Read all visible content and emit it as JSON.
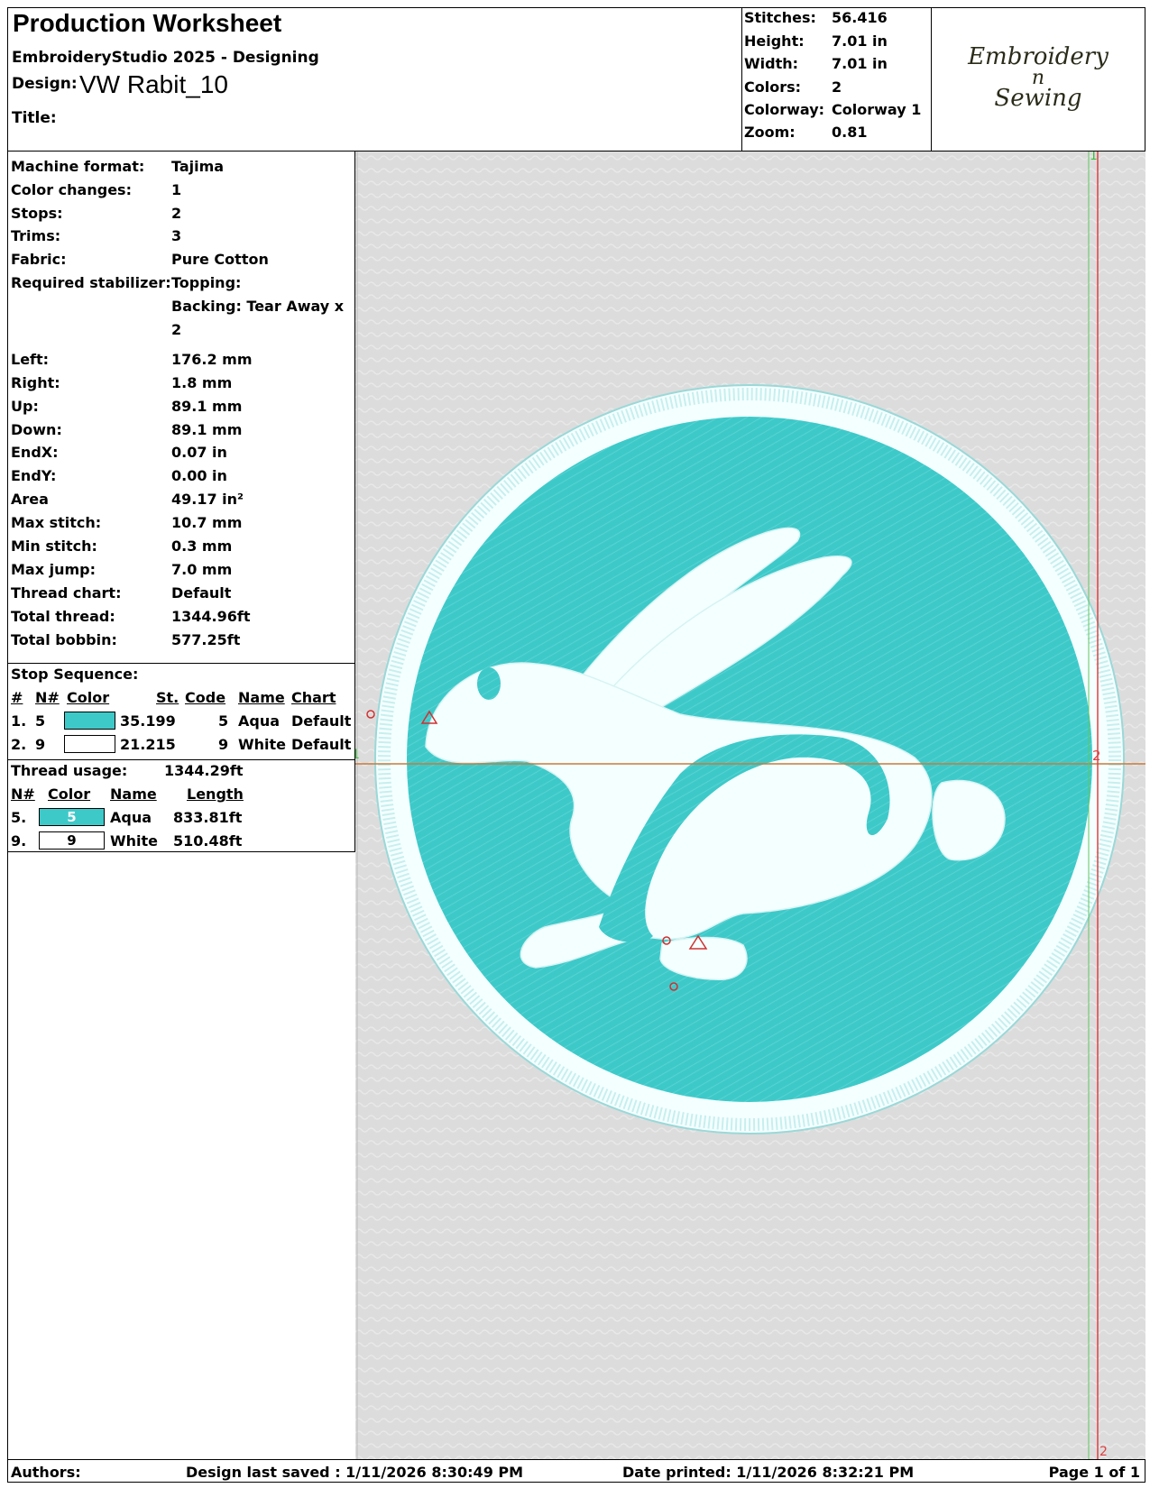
{
  "header": {
    "title": "Production Worksheet",
    "subtitle": "EmbroideryStudio 2025 - Designing",
    "design_label": "Design:",
    "design_value": "VW Rabit_10",
    "title_label": "Title:",
    "stats": [
      {
        "label": "Stitches:",
        "value": "56.416"
      },
      {
        "label": "Height:",
        "value": "7.01 in"
      },
      {
        "label": "Width:",
        "value": "7.01 in"
      },
      {
        "label": "Colors:",
        "value": "2"
      },
      {
        "label": "Colorway:",
        "value": "Colorway 1"
      },
      {
        "label": "Zoom:",
        "value": "0.81"
      }
    ],
    "logo_line1": "Embroidery",
    "logo_line2": "n",
    "logo_line3": "Sewing"
  },
  "details": [
    {
      "label": "Machine format:",
      "value": "Tajima"
    },
    {
      "label": "Color changes:",
      "value": "1"
    },
    {
      "label": "Stops:",
      "value": "2"
    },
    {
      "label": "Trims:",
      "value": "3"
    },
    {
      "label": "Fabric:",
      "value": "Pure Cotton"
    },
    {
      "label": "Required stabilizer:",
      "value": "Topping:"
    },
    {
      "label": "",
      "value": "Backing: Tear Away x"
    },
    {
      "label": "",
      "value": "2"
    },
    {
      "label": "Left:",
      "value": "176.2 mm"
    },
    {
      "label": "Right:",
      "value": "1.8 mm"
    },
    {
      "label": "Up:",
      "value": "89.1 mm"
    },
    {
      "label": "Down:",
      "value": "89.1 mm"
    },
    {
      "label": "EndX:",
      "value": "0.07 in"
    },
    {
      "label": "EndY:",
      "value": "0.00 in"
    },
    {
      "label": "Area",
      "value": "49.17 in²"
    },
    {
      "label": "Max stitch:",
      "value": "10.7 mm"
    },
    {
      "label": "Min stitch:",
      "value": "0.3 mm"
    },
    {
      "label": "Max jump:",
      "value": "7.0 mm"
    },
    {
      "label": "Thread chart:",
      "value": "Default"
    },
    {
      "label": "Total thread:",
      "value": "1344.96ft"
    },
    {
      "label": "Total bobbin:",
      "value": "577.25ft"
    }
  ],
  "stop_sequence": {
    "heading": "Stop Sequence:",
    "columns": [
      "#",
      "N#",
      "Color",
      "St.",
      "Code",
      "Name",
      "Chart"
    ],
    "rows": [
      {
        "num": "1.",
        "n": "5",
        "color": "#3ec9c9",
        "stitches": "35.199",
        "code": "5",
        "name": "Aqua",
        "chart": "Default"
      },
      {
        "num": "2.",
        "n": "9",
        "color": "#ffffff",
        "stitches": "21.215",
        "code": "9",
        "name": "White",
        "chart": "Default"
      }
    ]
  },
  "thread_usage": {
    "heading": "Thread usage:",
    "total": "1344.29ft",
    "columns": [
      "N#",
      "Color",
      "Name",
      "Length"
    ],
    "rows": [
      {
        "num": "5.",
        "code": "5",
        "color": "#3ec9c9",
        "name": "Aqua",
        "length": "833.81ft"
      },
      {
        "num": "9.",
        "code": "9",
        "color": "#ffffff",
        "name": "White",
        "length": "510.48ft"
      }
    ]
  },
  "canvas": {
    "marker_1": "1",
    "marker_2": "2",
    "aqua": "#3ec9c9",
    "white": "#f4ffff",
    "fabric": "#dcdcdc"
  },
  "footer": {
    "authors": "Authors:",
    "saved": "Design last saved : 1/11/2026 8:30:49 PM",
    "printed": "Date printed: 1/11/2026 8:32:21 PM",
    "page": "Page 1 of 1"
  }
}
